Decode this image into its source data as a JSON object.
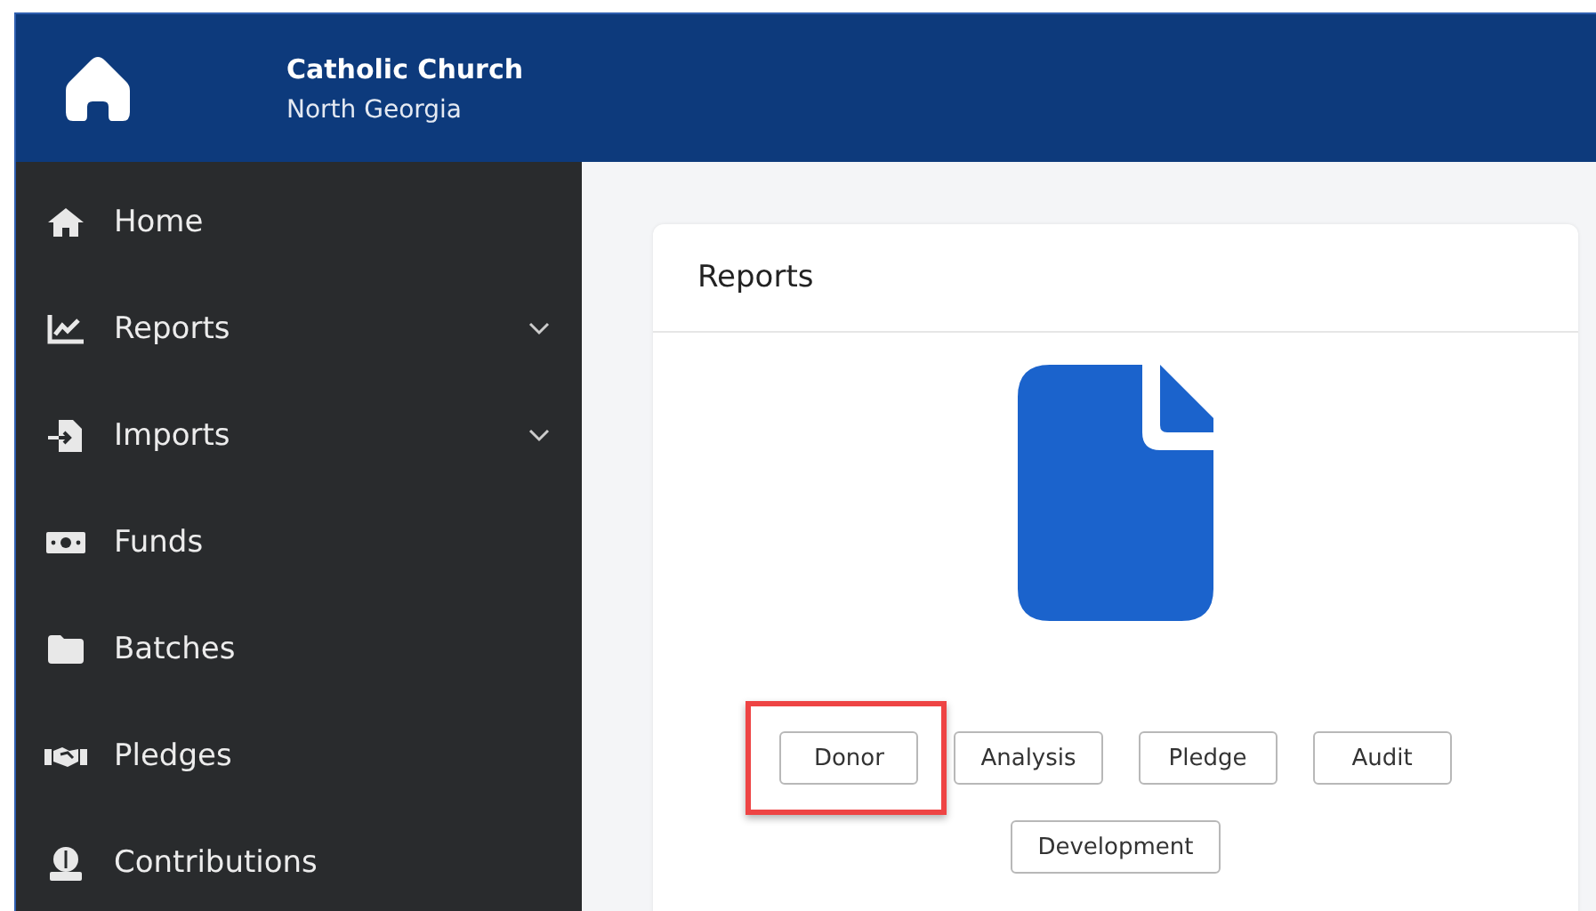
{
  "header": {
    "title": "Catholic Church",
    "subtitle": "North Georgia"
  },
  "sidebar": {
    "items": [
      {
        "label": "Home",
        "expandable": false
      },
      {
        "label": "Reports",
        "expandable": true
      },
      {
        "label": "Imports",
        "expandable": true
      },
      {
        "label": "Funds",
        "expandable": false
      },
      {
        "label": "Batches",
        "expandable": false
      },
      {
        "label": "Pledges",
        "expandable": false
      },
      {
        "label": "Contributions",
        "expandable": false
      }
    ]
  },
  "card": {
    "title": "Reports",
    "buttons": [
      {
        "label": "Donor",
        "highlighted": true
      },
      {
        "label": "Analysis",
        "highlighted": false
      },
      {
        "label": "Pledge",
        "highlighted": false
      },
      {
        "label": "Audit",
        "highlighted": false
      },
      {
        "label": "Development",
        "highlighted": false
      }
    ]
  }
}
